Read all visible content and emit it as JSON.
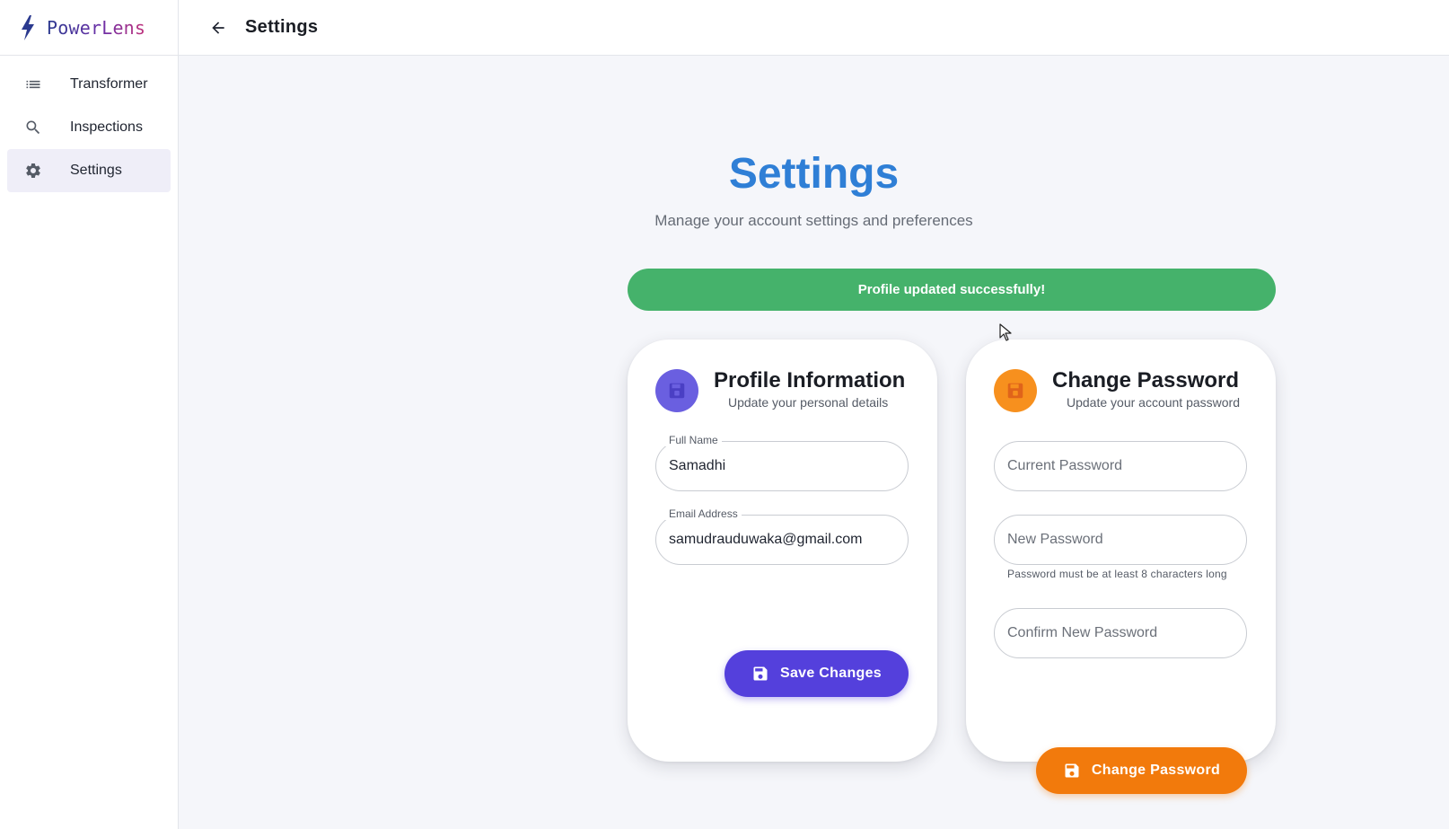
{
  "app": {
    "name": "PowerLens"
  },
  "sidebar": {
    "items": [
      {
        "label": "Transformer",
        "icon": "list-icon",
        "active": false
      },
      {
        "label": "Inspections",
        "icon": "search-icon",
        "active": false
      },
      {
        "label": "Settings",
        "icon": "gear-icon",
        "active": true
      }
    ]
  },
  "topbar": {
    "title": "Settings"
  },
  "page": {
    "title": "Settings",
    "subtitle": "Manage your account settings and preferences"
  },
  "alert": {
    "message": "Profile updated successfully!",
    "color": "#45b26b"
  },
  "profile": {
    "title": "Profile Information",
    "subtitle": "Update your personal details",
    "full_name_label": "Full Name",
    "full_name_value": "Samadhi",
    "email_label": "Email Address",
    "email_value": "samudrauduwaka@gmail.com",
    "save_label": "Save Changes",
    "accent": "#5440dc"
  },
  "password": {
    "title": "Change Password",
    "subtitle": "Update your account password",
    "current_placeholder": "Current Password",
    "new_placeholder": "New Password",
    "new_helper": "Password must be at least 8 characters long",
    "confirm_placeholder": "Confirm New Password",
    "change_label": "Change Password",
    "accent": "#f27a0c"
  },
  "colors": {
    "title_blue": "#2f7fd6",
    "background": "#f5f6fa"
  }
}
